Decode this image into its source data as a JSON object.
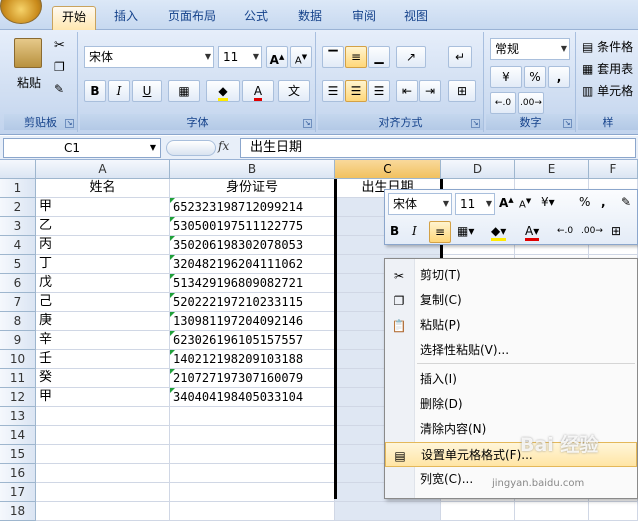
{
  "tabs": [
    "开始",
    "插入",
    "页面布局",
    "公式",
    "数据",
    "审阅",
    "视图"
  ],
  "ribbon": {
    "clipboard": {
      "paste": "粘贴",
      "label": "剪贴板"
    },
    "font": {
      "name": "宋体",
      "size": "11",
      "bold": "B",
      "italic": "I",
      "underline": "U",
      "phonetic": "文",
      "label": "字体"
    },
    "alignment": {
      "label": "对齐方式"
    },
    "number": {
      "format": "常规",
      "percent": "%",
      "comma": ",",
      "label": "数字"
    },
    "styles": {
      "conditional": "条件格",
      "table": "套用表",
      "cell": "单元格",
      "label": "样"
    }
  },
  "formula_bar": {
    "name_box": "C1",
    "fx": "fx",
    "content": "出生日期"
  },
  "columns": [
    "A",
    "B",
    "C",
    "D",
    "E",
    "F"
  ],
  "rows": [
    "1",
    "2",
    "3",
    "4",
    "5",
    "6",
    "7",
    "8",
    "9",
    "10",
    "11",
    "12",
    "13",
    "14",
    "15",
    "16",
    "17",
    "18"
  ],
  "sheet": {
    "header": {
      "a": "姓名",
      "b": "身份证号",
      "c": "出生日期"
    },
    "data": [
      {
        "name": "甲",
        "id": "652323198712099214"
      },
      {
        "name": "乙",
        "id": "530500197511122775"
      },
      {
        "name": "丙",
        "id": "350206198302078053"
      },
      {
        "name": "丁",
        "id": "320482196204111062"
      },
      {
        "name": "戊",
        "id": "513429196809082721"
      },
      {
        "name": "己",
        "id": "520222197210233115"
      },
      {
        "name": "庚",
        "id": "130981197204092146"
      },
      {
        "name": "辛",
        "id": "623026196105157557"
      },
      {
        "name": "壬",
        "id": "140212198209103188"
      },
      {
        "name": "癸",
        "id": "210727197307160079"
      },
      {
        "name": "甲",
        "id": "340404198405033104"
      }
    ]
  },
  "mini_toolbar": {
    "font": "宋体",
    "size": "11",
    "percent": "%",
    "comma": ",",
    "bold": "B",
    "italic": "I"
  },
  "context_menu": [
    {
      "label": "剪切(T)",
      "icon": "scissors-icon"
    },
    {
      "label": "复制(C)",
      "icon": "copy-icon"
    },
    {
      "label": "粘贴(P)",
      "icon": "paste-icon"
    },
    {
      "label": "选择性粘贴(V)...",
      "icon": ""
    },
    {
      "label": "插入(I)",
      "icon": ""
    },
    {
      "label": "删除(D)",
      "icon": ""
    },
    {
      "label": "清除内容(N)",
      "icon": ""
    },
    {
      "label": "设置单元格格式(F)...",
      "icon": "format-cells-icon"
    },
    {
      "label": "列宽(C)...",
      "icon": ""
    }
  ],
  "watermark": {
    "text": "Bai 经验",
    "url": "jingyan.baidu.com"
  }
}
